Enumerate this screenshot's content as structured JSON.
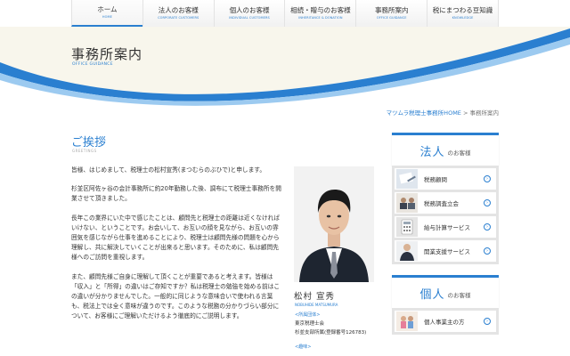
{
  "nav": [
    {
      "jp": "ホーム",
      "en": "HOME"
    },
    {
      "jp": "法人のお客様",
      "en": "CORPORATE CUSTOMERS"
    },
    {
      "jp": "個人のお客様",
      "en": "INDIVIDUAL CUSTOMERS"
    },
    {
      "jp": "相続・贈与のお客様",
      "en": "INHERITANCE & DONATION"
    },
    {
      "jp": "事務所案内",
      "en": "OFFICE GUIDANCE"
    },
    {
      "jp": "税にまつわる豆知識",
      "en": "KNOWLEDGE"
    }
  ],
  "header": {
    "title": "事務所案内",
    "subtitle": "OFFICE GUIDANCE"
  },
  "breadcrumb": {
    "home": "マツムラ税理士事務所HOME",
    "sep": " > ",
    "current": "事務所案内"
  },
  "greeting": {
    "title": "ご挨拶",
    "subtitle": "GREETINGS"
  },
  "paragraphs": [
    "皆様、はじめまして、税理士の松村宣秀(まつむらのぶひで)と申します。",
    "杉並区阿佐ヶ谷の会計事務所に約20年勤務した後、調布にて税理士事務所を開業させて頂きました。",
    "長年この業界にいた中で感じたことは、顧問先と税理士の距離は近くなければいけない、ということです。お会いして、お互いの顔を見ながら、お互いの雰囲気を感じながら仕事を進めることにより、税理士は顧問先様の問題を心から理解し、共に解決していくことが出来ると思います。そのために、私は顧問先様へのご訪問を重視します。",
    "また、顧問先様ご自身に理解して頂くことが重要であると考えます。皆様は「収入」と「所得」の違いはご存知ですか？私は税理士の勉強を始める前はこの違いが分かりませんでした。一般的に同じような意味合いで使われる言葉も、税法上では全く意味が違うのです。このような税務の分かりづらい部分について、お客様にご理解いただけるよう徹底的にご説明します。"
  ],
  "profile": {
    "name": "松村 宣秀",
    "name_en": "NOBUHIDE MATSUMURA",
    "affiliation_label": "<所属団体>",
    "affiliation_1": "東京税理士会",
    "affiliation_2": "杉並支部所属(登録番号126783)",
    "hobby_label": "<趣味>"
  },
  "sidebar": {
    "corporate": {
      "big": "法人",
      "small": "のお客様",
      "items": [
        {
          "label": "税務顧問"
        },
        {
          "label": "税務調査立会"
        },
        {
          "label": "給与計算サービス"
        },
        {
          "label": "開業支援サービス"
        }
      ]
    },
    "individual": {
      "big": "個人",
      "small": "のお客様",
      "items": [
        {
          "label": "個人事業主の方"
        }
      ]
    }
  },
  "colors": {
    "accent": "#2a7fd0",
    "hero_bg": "#f8f6ec",
    "wave_light": "#9ccaf0"
  }
}
